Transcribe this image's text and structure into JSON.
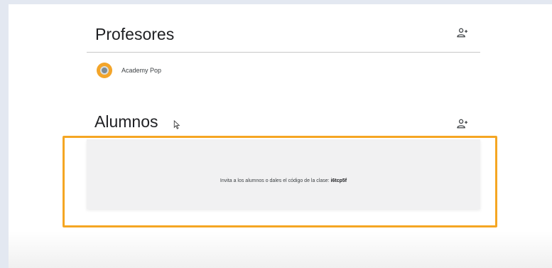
{
  "teachers": {
    "title": "Profesores",
    "add_icon": "person-add-icon",
    "items": [
      {
        "name": "Academy Pop",
        "avatar_color": "#f3a52a"
      }
    ]
  },
  "students": {
    "title": "Alumnos",
    "add_icon": "person-add-icon",
    "invite_text": "Invita a los alumnos o dales el código de la clase: ",
    "class_code": "i6tcp5f"
  },
  "colors": {
    "highlight": "#f5a623",
    "background": "#e3e8f1",
    "divider": "#c8c8c8"
  }
}
